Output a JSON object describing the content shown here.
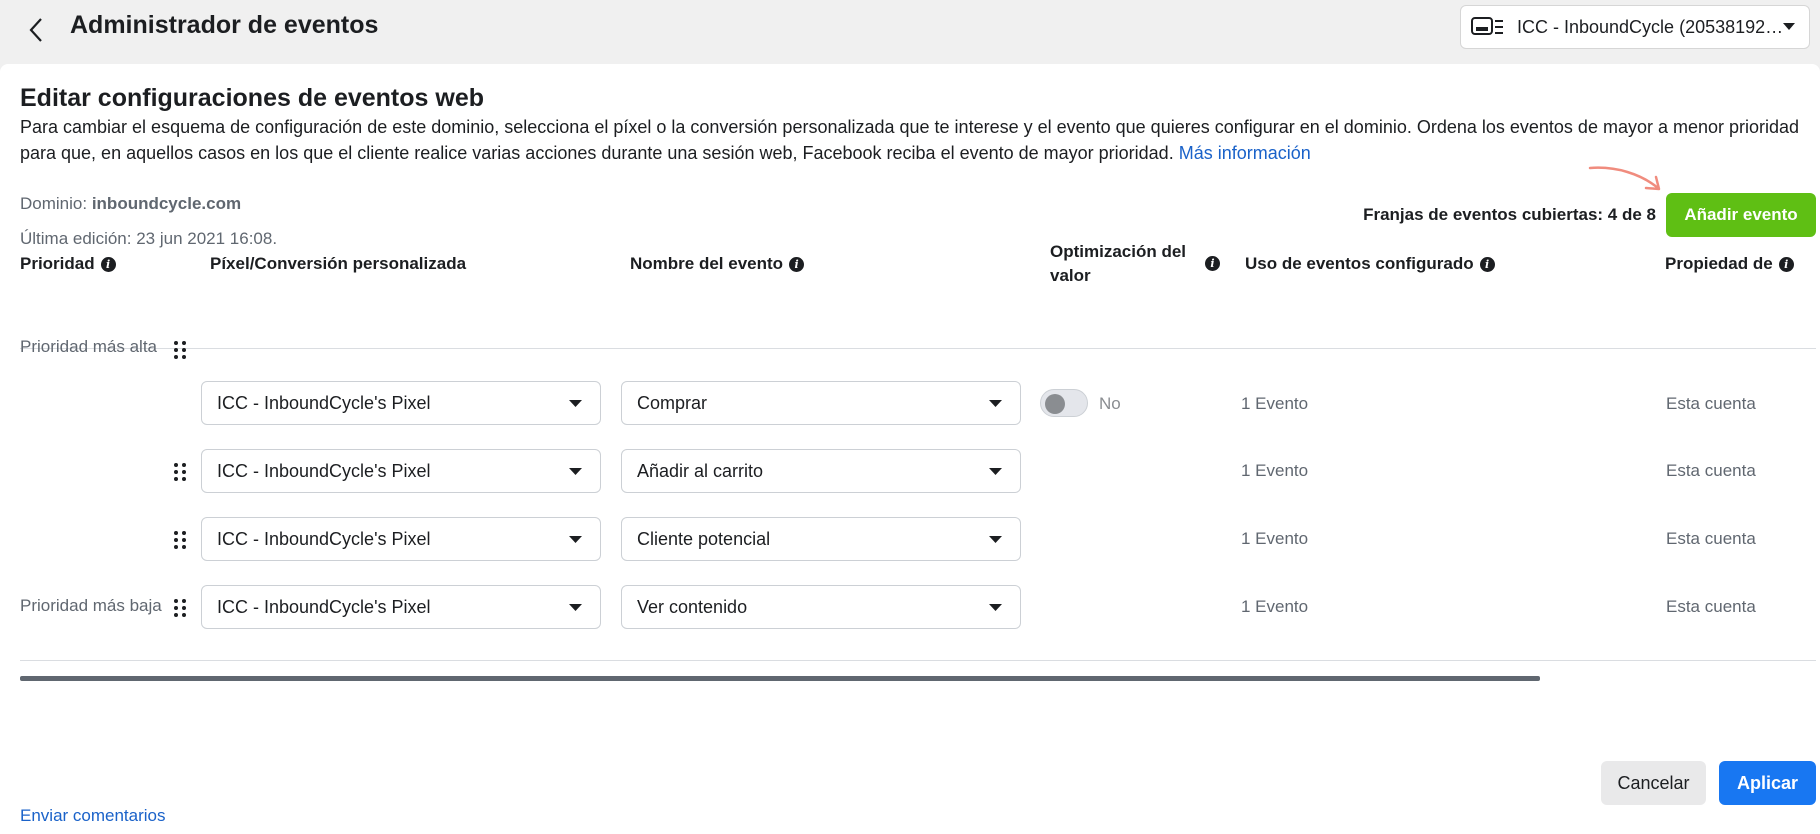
{
  "header": {
    "title": "Administrador de eventos",
    "account_name": "ICC - InboundCycle (2053819298..."
  },
  "main": {
    "title": "Editar configuraciones de eventos web",
    "description": "Para cambiar el esquema de configuración de este dominio, selecciona el píxel o la conversión personalizada que te interese y el evento que quieres configurar en el dominio. Ordena los eventos de mayor a menor prioridad para que, en aquellos casos en los que el cliente realice varias acciones durante una sesión web, Facebook reciba el evento de mayor prioridad.",
    "more_info_link": "Más información",
    "domain_label": "Dominio:",
    "domain_value": "inboundcycle.com",
    "last_edit": "Última edición: 23 jun 2021 16:08.",
    "slots_text": "Franjas de eventos cubiertas: 4 de 8",
    "add_event_label": "Añadir evento"
  },
  "table": {
    "headers": {
      "priority": "Prioridad",
      "pixel": "Píxel/Conversión personalizada",
      "event_name": "Nombre del evento",
      "value_opt_line1": "Optimización del",
      "value_opt_line2": "valor",
      "usage": "Uso de eventos configurado",
      "owner": "Propiedad de"
    },
    "rows": [
      {
        "priority_label": "Prioridad más alta",
        "pixel": "ICC - InboundCycle's Pixel",
        "event": "Comprar",
        "toggle_label": "No",
        "toggle_on": false,
        "usage": "1 Evento",
        "owner": "Esta cuenta"
      },
      {
        "priority_label": "",
        "pixel": "ICC - InboundCycle's Pixel",
        "event": "Añadir al carrito",
        "usage": "1 Evento",
        "owner": "Esta cuenta"
      },
      {
        "priority_label": "",
        "pixel": "ICC - InboundCycle's Pixel",
        "event": "Cliente potencial",
        "usage": "1 Evento",
        "owner": "Esta cuenta"
      },
      {
        "priority_label": "Prioridad más baja",
        "pixel": "ICC - InboundCycle's Pixel",
        "event": "Ver contenido",
        "usage": "1 Evento",
        "owner": "Esta cuenta"
      }
    ]
  },
  "footer": {
    "cancel_label": "Cancelar",
    "apply_label": "Aplicar",
    "feedback_link": "Enviar comentarios"
  },
  "icons": {
    "back": "chevron-left-icon",
    "account": "business-account-icon",
    "info": "info-icon",
    "drag": "drag-handle-icon",
    "caret": "caret-down-icon"
  },
  "colors": {
    "add_button": "#5fbf14",
    "apply_button": "#1877f2",
    "link": "#1a62c9",
    "annotation_arrow": "#f08c7e"
  }
}
